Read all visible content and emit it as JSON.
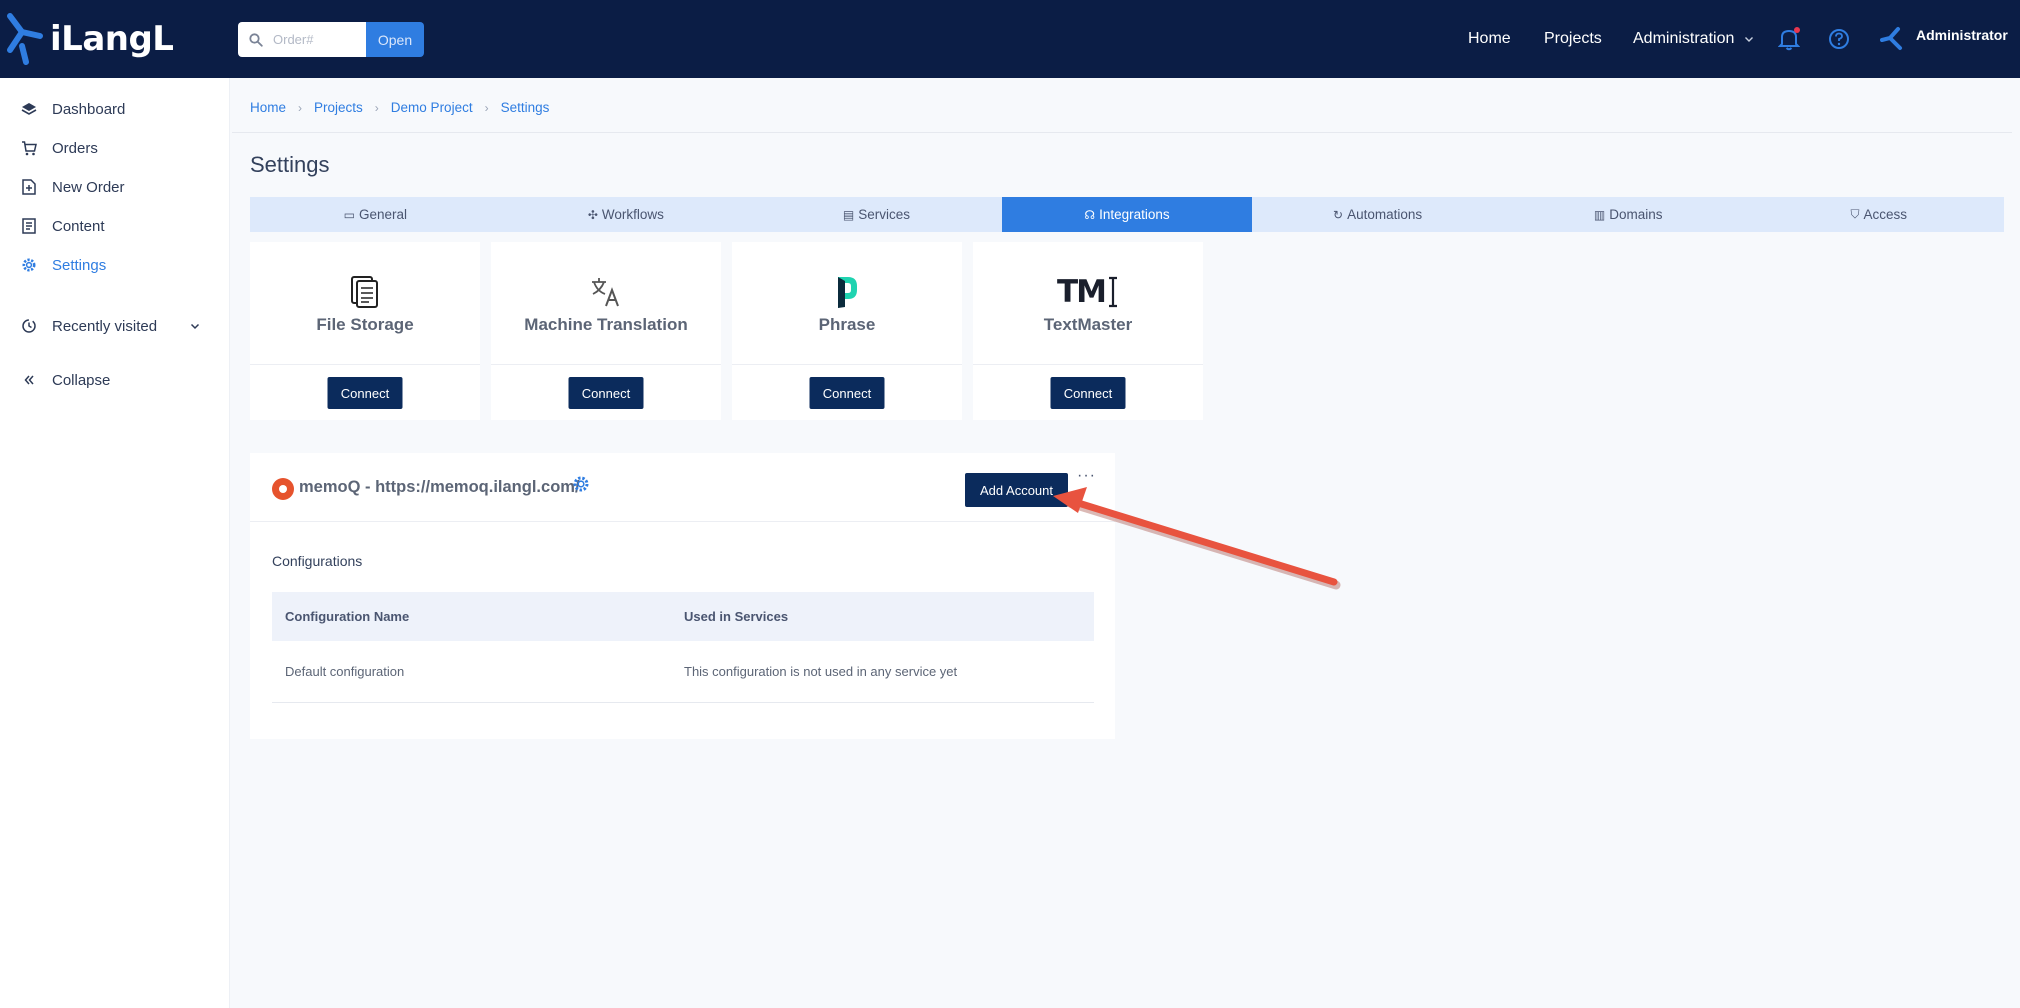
{
  "app": {
    "logo_text": "iLangL"
  },
  "search": {
    "placeholder": "Order#",
    "open_label": "Open"
  },
  "topnav": {
    "home": "Home",
    "projects": "Projects",
    "administration": "Administration",
    "user_name": "Administrator"
  },
  "sidebar": {
    "items": [
      {
        "label": "Dashboard",
        "icon": "layers-icon"
      },
      {
        "label": "Orders",
        "icon": "cart-icon"
      },
      {
        "label": "New Order",
        "icon": "new-document-icon"
      },
      {
        "label": "Content",
        "icon": "document-list-icon"
      },
      {
        "label": "Settings",
        "icon": "gear-icon",
        "active": true
      }
    ],
    "recently_visited": "Recently visited",
    "collapse": "Collapse"
  },
  "breadcrumb": [
    "Home",
    "Projects",
    "Demo Project",
    "Settings"
  ],
  "page": {
    "title": "Settings"
  },
  "tabs": [
    {
      "label": "General",
      "icon": "window-icon"
    },
    {
      "label": "Workflows",
      "icon": "move-icon"
    },
    {
      "label": "Services",
      "icon": "server-icon"
    },
    {
      "label": "Integrations",
      "icon": "headset-icon",
      "active": true
    },
    {
      "label": "Automations",
      "icon": "refresh-icon"
    },
    {
      "label": "Domains",
      "icon": "building-icon"
    },
    {
      "label": "Access",
      "icon": "shield-icon"
    }
  ],
  "integrations": [
    {
      "name": "File Storage",
      "icon": "file-storage-icon",
      "button": "Connect"
    },
    {
      "name": "Machine Translation",
      "icon": "translate-icon",
      "button": "Connect"
    },
    {
      "name": "Phrase",
      "icon": "phrase-logo-icon",
      "button": "Connect"
    },
    {
      "name": "TextMaster",
      "icon": "textmaster-logo-icon",
      "button": "Connect",
      "logo_text": "TM"
    }
  ],
  "memoq": {
    "title": "memoQ - https://memoq.ilangl.com/",
    "add_account": "Add Account",
    "more": "···",
    "configurations_label": "Configurations",
    "table": {
      "headers": [
        "Configuration Name",
        "Used in Services"
      ],
      "rows": [
        [
          "Default configuration",
          "This configuration is not used in any service yet"
        ]
      ]
    }
  },
  "colors": {
    "topbar": "#0b1d45",
    "accent": "#2f7de1",
    "button": "#0b2b5c",
    "annotation_arrow": "#e8533f",
    "notification_dot": "#e8364f"
  }
}
